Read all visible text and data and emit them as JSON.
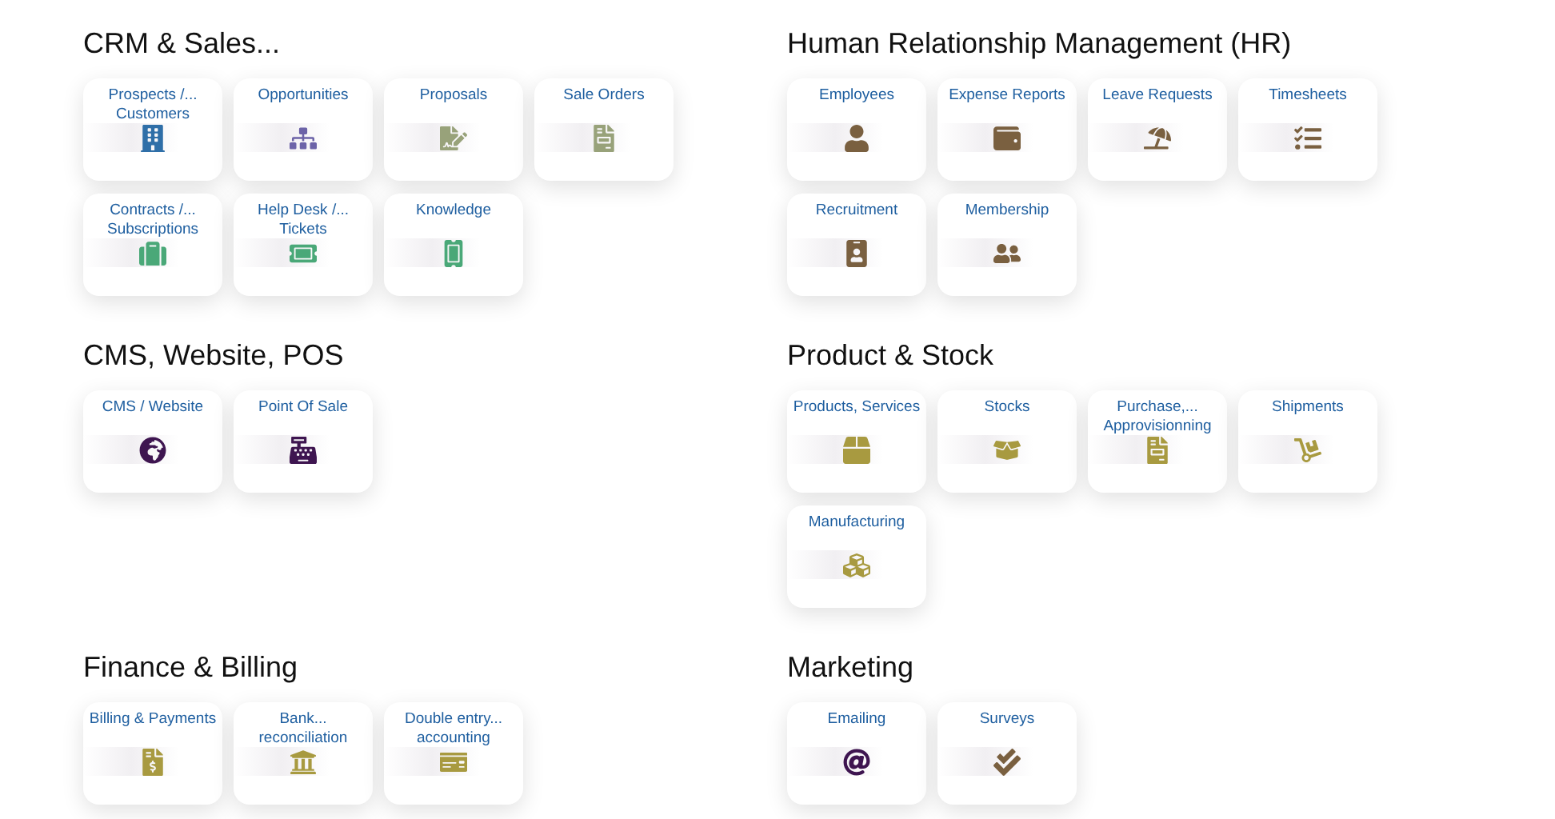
{
  "sections": [
    {
      "title": "CRM & Sales...",
      "apps": [
        {
          "label": "Prospects /... Customers",
          "kind": "building",
          "color": "#2f6fa8"
        },
        {
          "label": "Opportunities",
          "kind": "sitemap",
          "color": "#6c63a8"
        },
        {
          "label": "Proposals",
          "kind": "signature",
          "color": "#98a27a"
        },
        {
          "label": "Sale Orders",
          "kind": "invoice",
          "color": "#98a27a"
        },
        {
          "label": "Contracts /... Subscriptions",
          "kind": "suitcase",
          "color": "#4aa878"
        },
        {
          "label": "Help Desk /... Tickets",
          "kind": "ticket",
          "color": "#4aa878"
        },
        {
          "label": "Knowledge",
          "kind": "vticket",
          "color": "#4aa878"
        }
      ]
    },
    {
      "title": "Human Relationship Management (HR)",
      "apps": [
        {
          "label": "Employees",
          "kind": "user",
          "color": "#7a6040"
        },
        {
          "label": "Expense Reports",
          "kind": "wallet",
          "color": "#7a6040"
        },
        {
          "label": "Leave Requests",
          "kind": "umbrella",
          "color": "#7a6040"
        },
        {
          "label": "Timesheets",
          "kind": "tasks",
          "color": "#7a6040"
        },
        {
          "label": "Recruitment",
          "kind": "badge",
          "color": "#7a6040"
        },
        {
          "label": "Membership",
          "kind": "users",
          "color": "#7a6040"
        }
      ]
    },
    {
      "title": "CMS, Website, POS",
      "apps": [
        {
          "label": "CMS / Website",
          "kind": "globe",
          "color": "#3e1550"
        },
        {
          "label": "Point Of Sale",
          "kind": "register",
          "color": "#3e1550"
        }
      ]
    },
    {
      "title": "Product & Stock",
      "apps": [
        {
          "label": "Products, Services",
          "kind": "box",
          "color": "#a89a40"
        },
        {
          "label": "Stocks",
          "kind": "openbox",
          "color": "#a89a40"
        },
        {
          "label": "Purchase,... Approvisionning",
          "kind": "invoice",
          "color": "#a89a40"
        },
        {
          "label": "Shipments",
          "kind": "dolly",
          "color": "#a89a40"
        },
        {
          "label": "Manufacturing",
          "kind": "cubes",
          "color": "#a89a40"
        }
      ]
    },
    {
      "title": "Finance & Billing",
      "apps": [
        {
          "label": "Billing & Payments",
          "kind": "bill",
          "color": "#a89a40"
        },
        {
          "label": "Bank... reconciliation",
          "kind": "bank",
          "color": "#a89a40"
        },
        {
          "label": "Double entry... accounting",
          "kind": "check",
          "color": "#a89a40"
        }
      ]
    },
    {
      "title": "Marketing",
      "apps": [
        {
          "label": "Emailing",
          "kind": "at",
          "color": "#3e1550"
        },
        {
          "label": "Surveys",
          "kind": "ticks",
          "color": "#7a6040"
        }
      ]
    }
  ]
}
